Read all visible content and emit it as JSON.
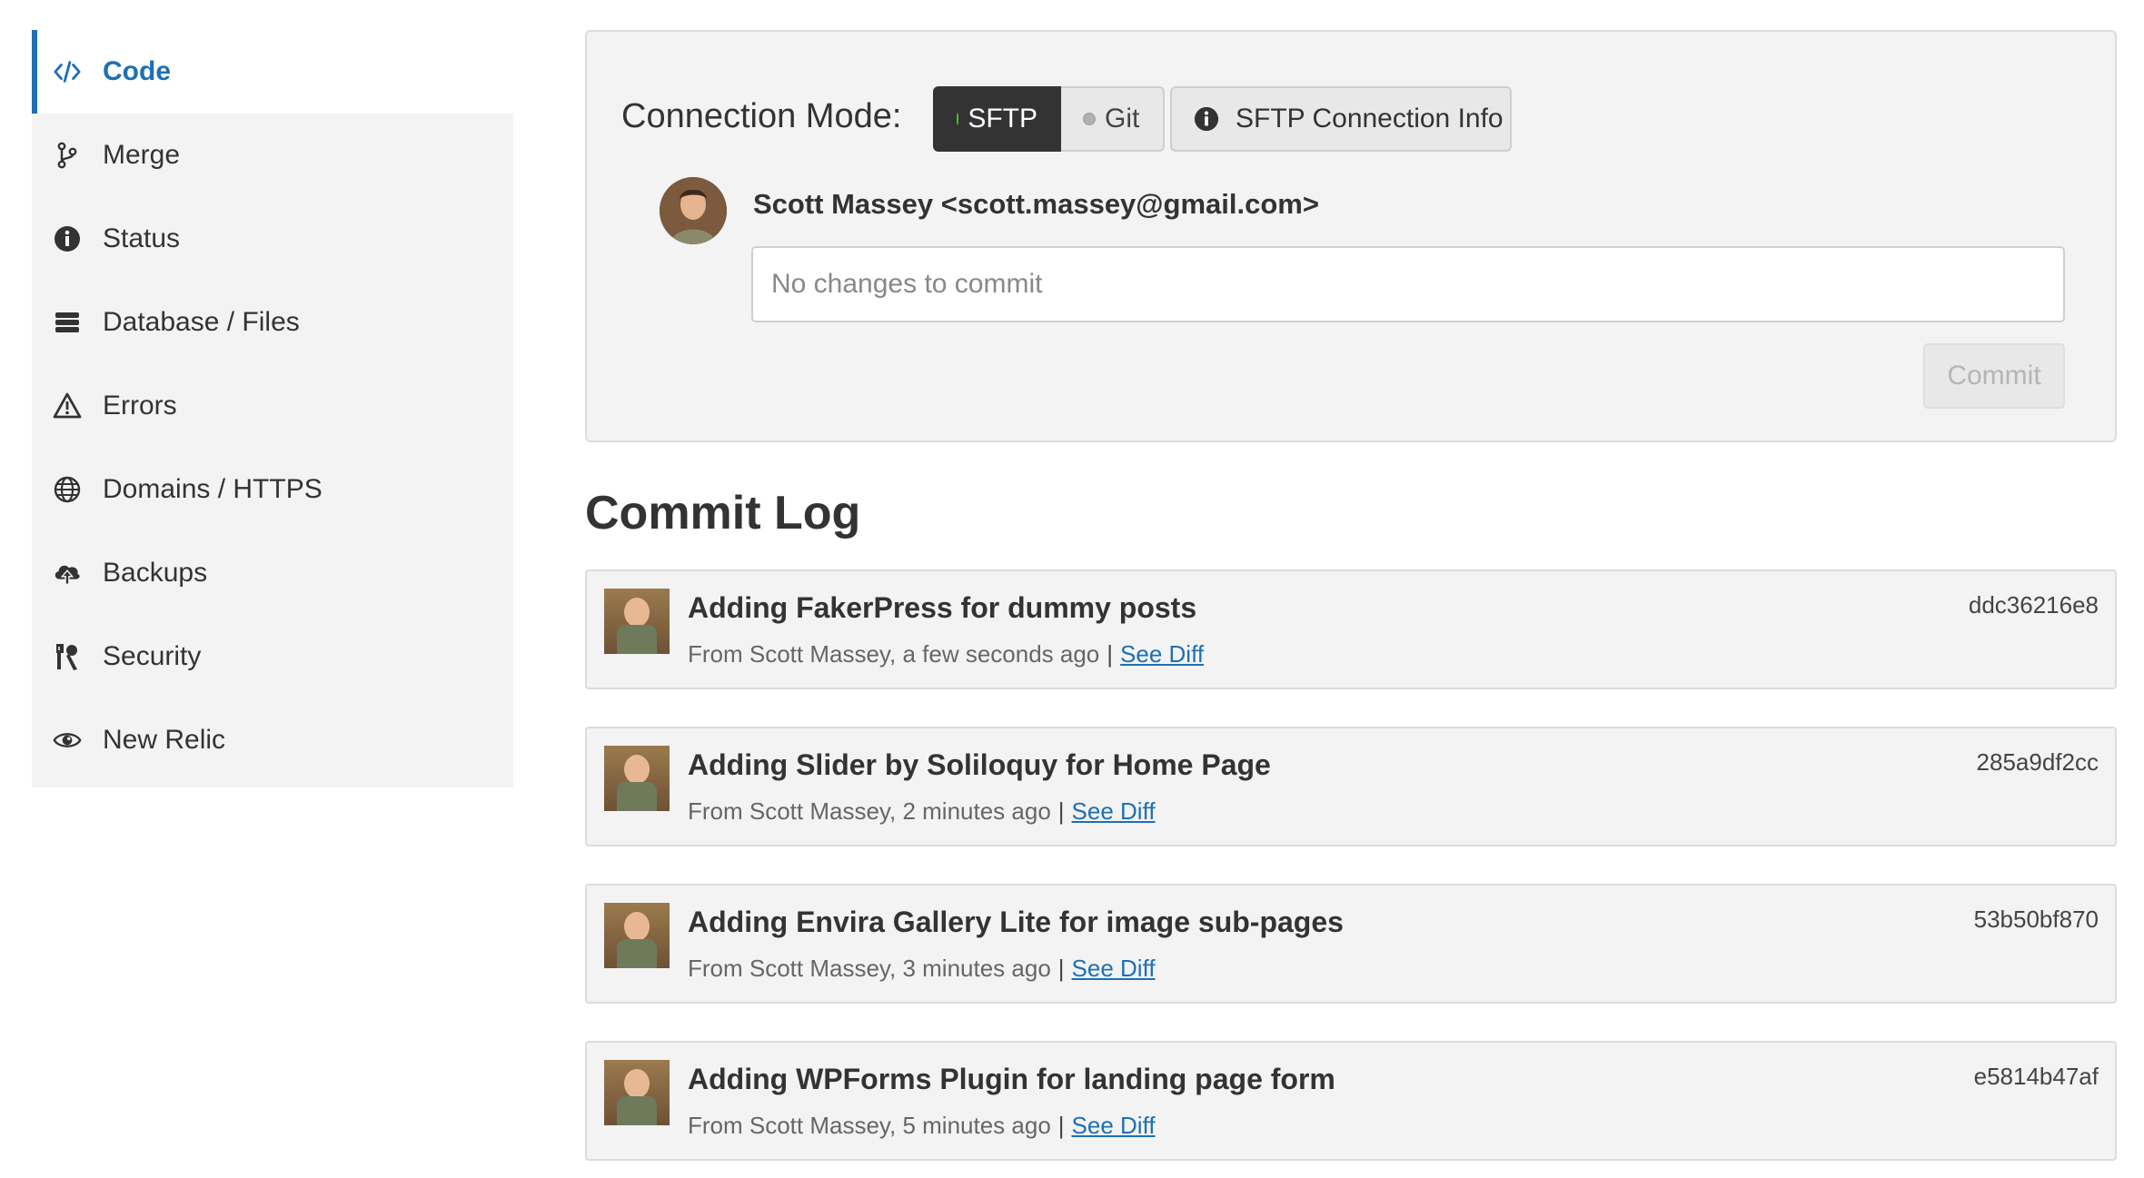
{
  "sidebar": {
    "items": [
      {
        "label": "Code",
        "icon": "code-icon",
        "active": true
      },
      {
        "label": "Merge",
        "icon": "merge-icon"
      },
      {
        "label": "Status",
        "icon": "info-icon"
      },
      {
        "label": "Database / Files",
        "icon": "database-icon"
      },
      {
        "label": "Errors",
        "icon": "warning-icon"
      },
      {
        "label": "Domains / HTTPS",
        "icon": "globe-icon"
      },
      {
        "label": "Backups",
        "icon": "cloud-upload-icon"
      },
      {
        "label": "Security",
        "icon": "security-icon"
      },
      {
        "label": "New Relic",
        "icon": "eye-icon"
      }
    ]
  },
  "connection": {
    "mode_label": "Connection Mode:",
    "sftp_label": "SFTP",
    "git_label": "Git",
    "info_label": "SFTP Connection Info",
    "active_mode": "SFTP"
  },
  "commit_form": {
    "author": "Scott Massey <scott.massey@gmail.com>",
    "placeholder": "No changes to commit",
    "value": "",
    "commit_label": "Commit"
  },
  "commit_log": {
    "title": "Commit Log",
    "entries": [
      {
        "message": "Adding FakerPress for dummy posts",
        "meta": "From Scott Massey, a few seconds ago",
        "sep": "|",
        "link": "See Diff",
        "hash": "ddc36216e8"
      },
      {
        "message": "Adding Slider by Soliloquy for Home Page",
        "meta": "From Scott Massey, 2 minutes ago",
        "sep": "|",
        "link": "See Diff",
        "hash": "285a9df2cc"
      },
      {
        "message": "Adding Envira Gallery Lite for image sub-pages",
        "meta": "From Scott Massey, 3 minutes ago",
        "sep": "|",
        "link": "See Diff",
        "hash": "53b50bf870"
      },
      {
        "message": "Adding WPForms Plugin for landing page form",
        "meta": "From Scott Massey, 5 minutes ago",
        "sep": "|",
        "link": "See Diff",
        "hash": "e5814b47af"
      }
    ]
  },
  "colors": {
    "accent": "#1e6fb5",
    "panel_bg": "#f3f3f3",
    "active_toggle_bg": "#333333",
    "sftp_dot": "#43c61c",
    "git_dot": "#b0b0b0"
  }
}
